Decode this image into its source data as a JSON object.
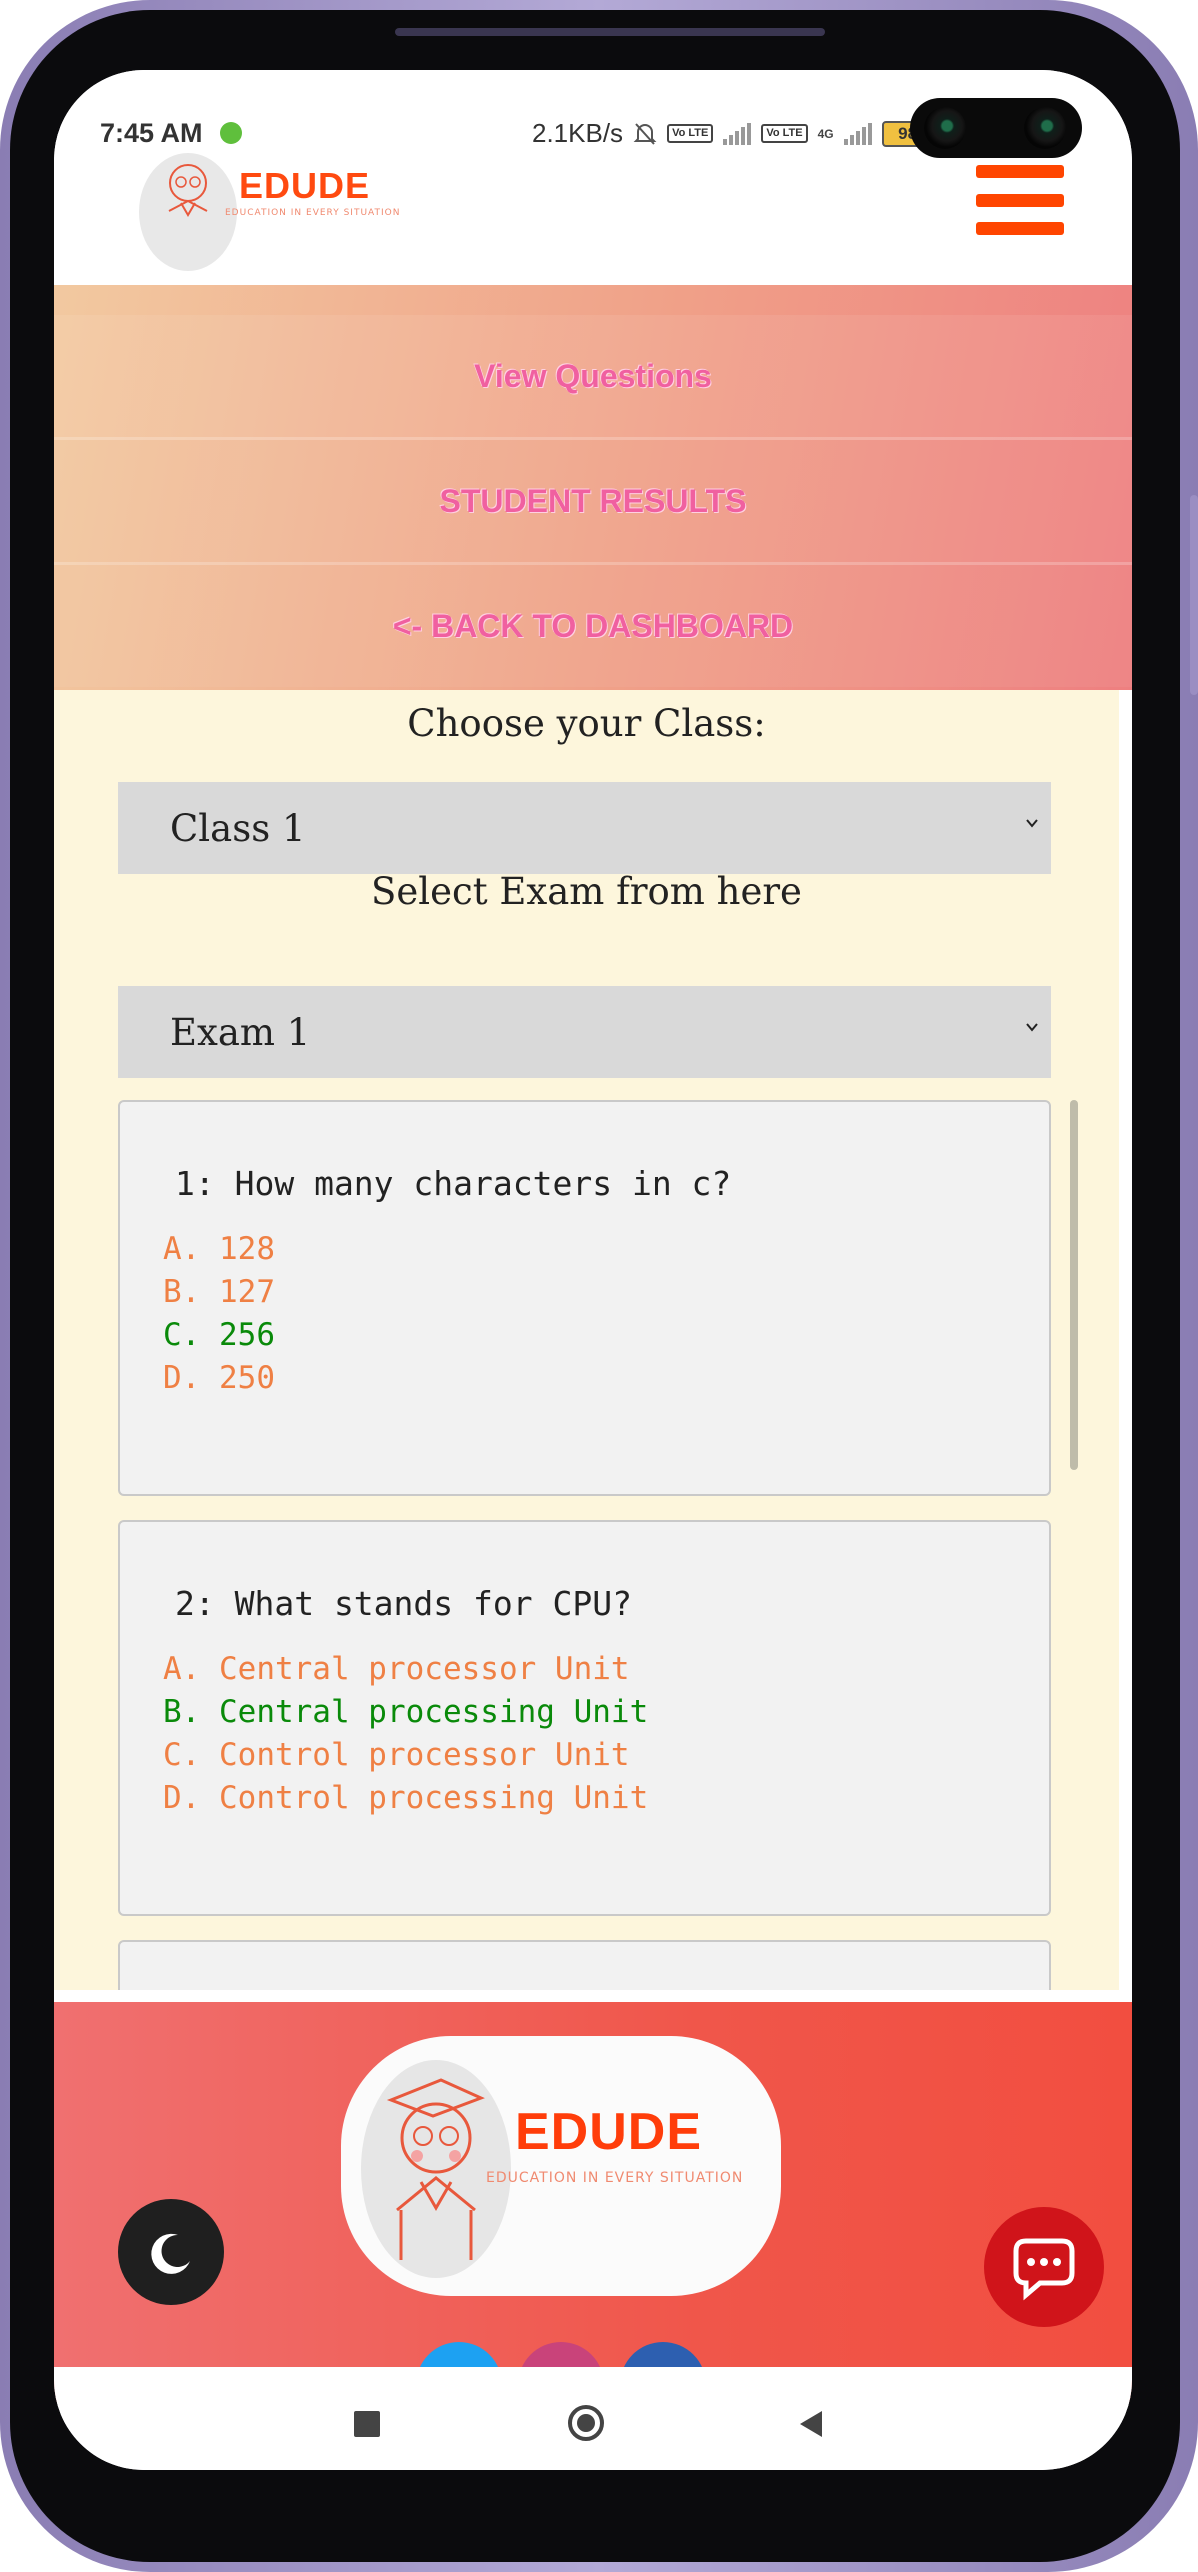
{
  "status_bar": {
    "time": "7:45 AM",
    "network_speed": "2.1KB/s",
    "lte_badge": "Vo LTE",
    "network_4g": "4G",
    "battery": "98",
    "icons": [
      "shield-icon",
      "bell-muted-icon",
      "signal-icon",
      "battery-icon"
    ]
  },
  "header": {
    "logo_name": "EDUDE",
    "logo_tagline": "EDUCATION IN EVERY SITUATION",
    "menu_icon": "hamburger-icon",
    "accent_color": "#ff4500"
  },
  "nav": {
    "items": [
      {
        "label": "View Questions"
      },
      {
        "label": "STUDENT RESULTS"
      },
      {
        "label": "<- BACK TO DASHBOARD"
      }
    ],
    "text_color": "#f060a0"
  },
  "main": {
    "choose_class_label": "Choose your Class:",
    "class_select": {
      "value": "Class 1"
    },
    "select_exam_label": "Select Exam from here",
    "exam_select": {
      "value": "Exam 1"
    },
    "questions": [
      {
        "title": "1: How many characters in c?",
        "options": [
          {
            "text": "A. 128",
            "correct": false
          },
          {
            "text": "B. 127",
            "correct": false
          },
          {
            "text": "C. 256",
            "correct": true
          },
          {
            "text": "D. 250",
            "correct": false
          }
        ]
      },
      {
        "title": "2: What stands for CPU?",
        "options": [
          {
            "text": "A. Central processor Unit",
            "correct": false
          },
          {
            "text": "B. Central processing Unit",
            "correct": true
          },
          {
            "text": "C. Control processor Unit",
            "correct": false
          },
          {
            "text": "D. Control processing Unit",
            "correct": false
          }
        ]
      }
    ],
    "correct_color": "#0a8a0a",
    "option_color": "#ef8044"
  },
  "footer": {
    "logo_name": "EDUDE",
    "logo_tagline": "EDUCATION IN EVERY SITUATION",
    "dark_mode_icon": "moon-icon",
    "chat_icon": "chat-bubble-icon",
    "social": [
      "twitter-icon",
      "instagram-icon",
      "facebook-icon"
    ]
  },
  "android_nav": [
    "recents-icon",
    "home-icon",
    "back-icon"
  ]
}
